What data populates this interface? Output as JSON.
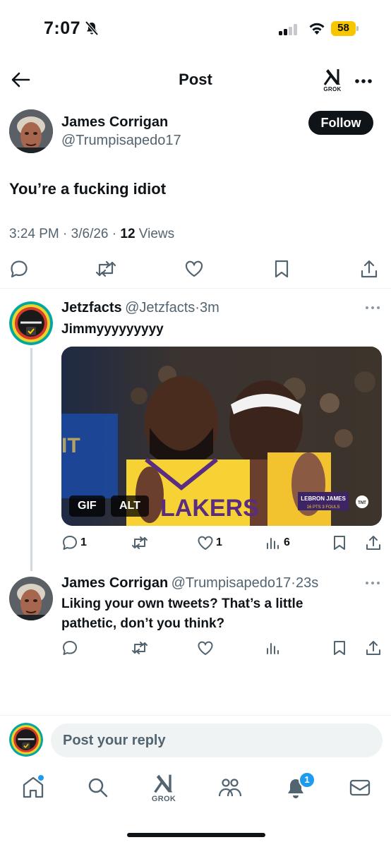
{
  "status_bar": {
    "time": "7:07",
    "battery": "58",
    "battery_color": "#f7c600",
    "icons": [
      "bell-slash-icon",
      "cell-signal-icon",
      "wifi-icon",
      "battery-icon"
    ]
  },
  "nav": {
    "title": "Post",
    "grok_label": "GROK",
    "icons": [
      "back-arrow-icon",
      "grok-icon",
      "more-icon"
    ]
  },
  "main_post": {
    "author_name": "James Corrigan",
    "author_handle": "@Trumpisapedo17",
    "follow_label": "Follow",
    "text": "You’re a fucking idiot",
    "time": "3:24 PM",
    "date": "3/6/26",
    "views_count": "12",
    "views_label": "Views",
    "separator": "·",
    "action_icons": [
      "reply-icon",
      "repost-icon",
      "like-icon",
      "bookmark-icon",
      "share-icon"
    ]
  },
  "reply_1": {
    "author_name": "Jetzfacts",
    "author_handle": "@Jetzfacts",
    "time": "3m",
    "separator": "·",
    "text": "Jimmyyyyyyyyy",
    "media": {
      "gif_badge": "GIF",
      "alt_badge": "ALT",
      "jersey_text": "LAKERS",
      "score_title": "LEBRON JAMES",
      "score_line": "16 PTS   3 FOULS",
      "network": "TNT"
    },
    "reply_count": "1",
    "like_count": "1",
    "view_count": "6"
  },
  "reply_2": {
    "author_name": "James Corrigan",
    "author_handle": "@Trumpisapedo17",
    "time": "23s",
    "separator": "·",
    "text_line_1": "Liking your own tweets? That’s a little",
    "text_line_2": "pathetic, don’t you think?"
  },
  "composer": {
    "placeholder": "Post your reply"
  },
  "tab_bar": {
    "grok_label": "GROK",
    "notification_badge": "1",
    "accent": "#1d9bf0",
    "items": [
      "home-icon",
      "search-icon",
      "grok-icon",
      "communities-icon",
      "notifications-icon",
      "messages-icon"
    ]
  }
}
